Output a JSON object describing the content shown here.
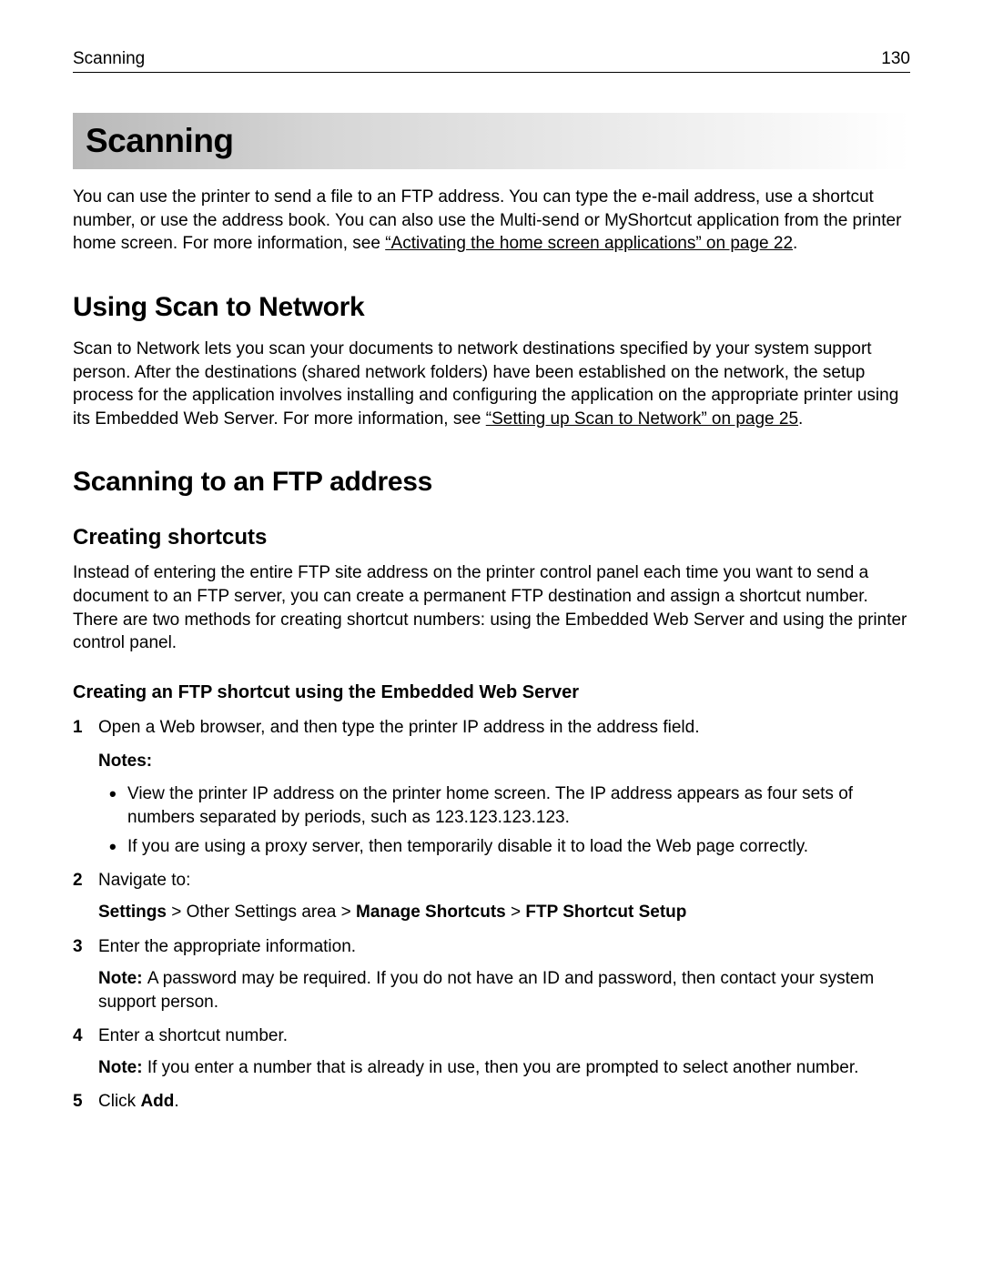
{
  "header": {
    "section": "Scanning",
    "page_number": "130"
  },
  "title": "Scanning",
  "intro": {
    "text_before_ref": "You can use the printer to send a file to an FTP address. You can type the e-mail address, use a shortcut number, or use the address book. You can also use the Multi-send or MyShortcut application from the printer home screen. For more information, see ",
    "ref": "“Activating the home screen applications” on page 22",
    "text_after_ref": "."
  },
  "section1": {
    "heading": "Using Scan to Network",
    "text_before_ref": "Scan to Network lets you scan your documents to network destinations specified by your system support person. After the destinations (shared network folders) have been established on the network, the setup process for the application involves installing and configuring the application on the appropriate printer using its Embedded Web Server. For more information, see ",
    "ref": "“Setting up Scan to Network” on page 25",
    "text_after_ref": "."
  },
  "section2": {
    "heading": "Scanning to an FTP address",
    "sub1": {
      "heading": "Creating shortcuts",
      "body": "Instead of entering the entire FTP site address on the printer control panel each time you want to send a document to an FTP server, you can create a permanent FTP destination and assign a shortcut number. There are two methods for creating shortcut numbers: using the Embedded Web Server and using the printer control panel."
    },
    "sub2": {
      "heading": "Creating an FTP shortcut using the Embedded Web Server",
      "steps": {
        "s1": {
          "text": "Open a Web browser, and then type the printer IP address in the address field.",
          "notes_heading": "Notes:",
          "note1": "View the printer IP address on the printer home screen. The IP address appears as four sets of numbers separated by periods, such as 123.123.123.123.",
          "note2": "If you are using a proxy server, then temporarily disable it to load the Web page correctly."
        },
        "s2": {
          "text": "Navigate to:",
          "path_bold1": "Settings",
          "path_sep1": " > ",
          "path_plain": "Other Settings area",
          "path_sep2": " > ",
          "path_bold2": "Manage Shortcuts",
          "path_sep3": " > ",
          "path_bold3": "FTP Shortcut Setup"
        },
        "s3": {
          "text": "Enter the appropriate information.",
          "note_label": "Note: ",
          "note_text": "A password may be required. If you do not have an ID and password, then contact your system support person."
        },
        "s4": {
          "text": "Enter a shortcut number.",
          "note_label": "Note: ",
          "note_text": "If you enter a number that is already in use, then you are prompted to select another number."
        },
        "s5": {
          "text_before": "Click ",
          "bold": "Add",
          "text_after": "."
        }
      }
    }
  }
}
